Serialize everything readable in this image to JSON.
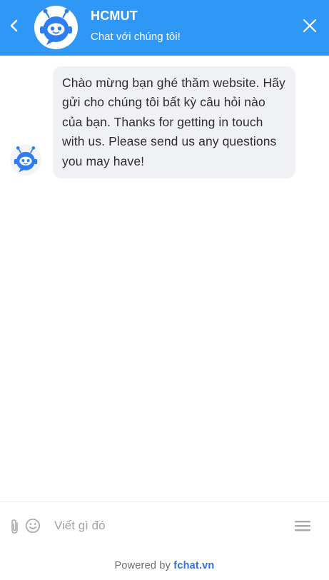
{
  "header": {
    "title": "HCMUT",
    "subtitle": "Chat với chúng tôi!",
    "back_icon": "chevron-left-icon",
    "close_icon": "close-icon",
    "avatar": "robot-avatar-icon"
  },
  "messages": [
    {
      "sender": "bot",
      "text": "Chào mừng bạn ghé thăm website. Hãy gửi cho chúng tôi bất kỳ câu hỏi nào của bạn. Thanks for getting in touch with us. Please send us any questions you may have!"
    }
  ],
  "composer": {
    "placeholder": "Viết gì đó",
    "value": "",
    "attach_icon": "paperclip-icon",
    "emoji_icon": "smiley-icon",
    "menu_icon": "hamburger-menu-icon"
  },
  "footer": {
    "prefix": "Powered by",
    "link": "fchat.vn"
  },
  "colors": {
    "header": "#2f97f5",
    "bubble": "#f0f1f4",
    "link": "#2f73e0"
  }
}
